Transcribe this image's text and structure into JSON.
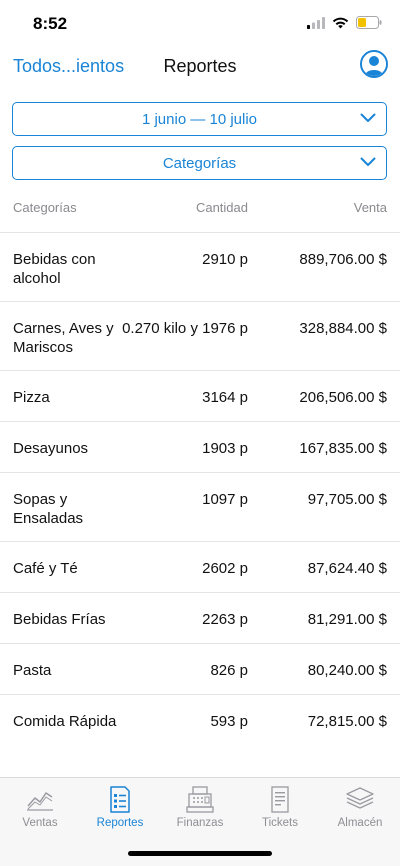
{
  "status_bar": {
    "time": "8:52"
  },
  "navbar": {
    "back_label": "Todos...ientos",
    "title": "Reportes"
  },
  "filters": {
    "date_range": "1 junio — 10 julio",
    "category": "Categorías"
  },
  "table": {
    "headers": {
      "category": "Categorías",
      "quantity": "Cantidad",
      "sale": "Venta"
    },
    "rows": [
      {
        "category": "Bebidas con alcohol",
        "quantity": "2910 p",
        "sale": "889,706.00 $"
      },
      {
        "category": "Carnes, Aves y Mariscos",
        "quantity": "0.270 kilo y 1976 p",
        "sale": "328,884.00 $"
      },
      {
        "category": "Pizza",
        "quantity": "3164 p",
        "sale": "206,506.00 $"
      },
      {
        "category": "Desayunos",
        "quantity": "1903 p",
        "sale": "167,835.00 $"
      },
      {
        "category": "Sopas y Ensaladas",
        "quantity": "1097 p",
        "sale": "97,705.00 $"
      },
      {
        "category": "Café y Té",
        "quantity": "2602 p",
        "sale": "87,624.40 $"
      },
      {
        "category": "Bebidas Frías",
        "quantity": "2263 p",
        "sale": "81,291.00 $"
      },
      {
        "category": "Pasta",
        "quantity": "826 p",
        "sale": "80,240.00 $"
      },
      {
        "category": "Comida Rápida",
        "quantity": "593 p",
        "sale": "72,815.00 $"
      }
    ]
  },
  "tabbar": {
    "tabs": [
      {
        "label": "Ventas",
        "icon": "chart-line-icon",
        "active": false
      },
      {
        "label": "Reportes",
        "icon": "report-document-icon",
        "active": true
      },
      {
        "label": "Finanzas",
        "icon": "cash-register-icon",
        "active": false
      },
      {
        "label": "Tickets",
        "icon": "receipt-icon",
        "active": false
      },
      {
        "label": "Almacén",
        "icon": "layers-stack-icon",
        "active": false
      }
    ]
  },
  "colors": {
    "accent": "#1a84d6",
    "inactive": "#8e8e93",
    "battery": "#f2c200"
  }
}
